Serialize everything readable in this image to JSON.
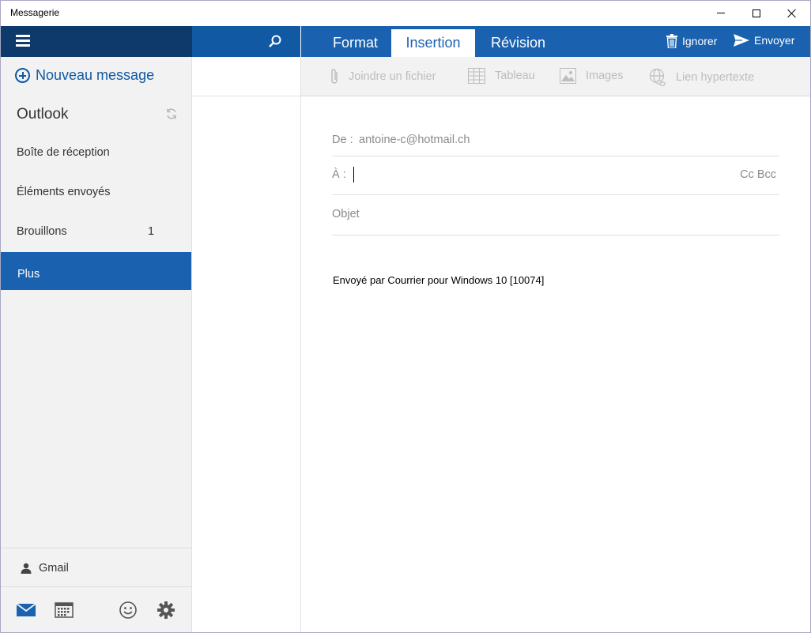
{
  "window": {
    "title": "Messagerie"
  },
  "nav": {
    "new_message": "Nouveau message",
    "account": "Outlook",
    "folders": [
      {
        "label": "Boîte de réception",
        "count": ""
      },
      {
        "label": "Éléments envoyés",
        "count": ""
      },
      {
        "label": "Brouillons",
        "count": "1"
      },
      {
        "label": "Plus",
        "count": ""
      }
    ],
    "selected_folder": "Plus",
    "other_account": "Gmail",
    "bottom_icons": [
      "mail-icon",
      "calendar-icon",
      "smiley-icon",
      "gear-icon"
    ]
  },
  "ribbon": {
    "tabs": [
      "Format",
      "Insertion",
      "Révision"
    ],
    "active_tab": "Insertion",
    "actions": {
      "discard": "Ignorer",
      "send": "Envoyer"
    },
    "tools": {
      "attach": "Joindre un fichier",
      "table": "Tableau",
      "images": "Images",
      "link": "Lien hypertexte"
    }
  },
  "compose": {
    "from_label": "De :",
    "from_value": "antoine-c@hotmail.ch",
    "to_label": "À :",
    "to_value": "",
    "cc_bcc": "Cc Bcc",
    "subject_placeholder": "Objet",
    "signature": "Envoyé par Courrier pour Windows 10 [10074]"
  },
  "colors": {
    "nav_header": "#0e3a6b",
    "search_header": "#1159a3",
    "ribbon": "#1a62b0",
    "selected_folder": "#1a62b0",
    "accent_text": "#1159a3"
  }
}
